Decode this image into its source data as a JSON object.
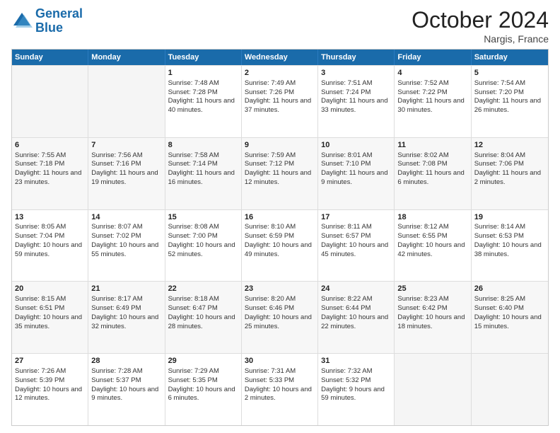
{
  "header": {
    "logo_line1": "General",
    "logo_line2": "Blue",
    "month": "October 2024",
    "location": "Nargis, France"
  },
  "days_of_week": [
    "Sunday",
    "Monday",
    "Tuesday",
    "Wednesday",
    "Thursday",
    "Friday",
    "Saturday"
  ],
  "rows": [
    [
      {
        "day": "",
        "empty": true
      },
      {
        "day": "",
        "empty": true
      },
      {
        "day": "1",
        "sunrise": "Sunrise: 7:48 AM",
        "sunset": "Sunset: 7:28 PM",
        "daylight": "Daylight: 11 hours and 40 minutes."
      },
      {
        "day": "2",
        "sunrise": "Sunrise: 7:49 AM",
        "sunset": "Sunset: 7:26 PM",
        "daylight": "Daylight: 11 hours and 37 minutes."
      },
      {
        "day": "3",
        "sunrise": "Sunrise: 7:51 AM",
        "sunset": "Sunset: 7:24 PM",
        "daylight": "Daylight: 11 hours and 33 minutes."
      },
      {
        "day": "4",
        "sunrise": "Sunrise: 7:52 AM",
        "sunset": "Sunset: 7:22 PM",
        "daylight": "Daylight: 11 hours and 30 minutes."
      },
      {
        "day": "5",
        "sunrise": "Sunrise: 7:54 AM",
        "sunset": "Sunset: 7:20 PM",
        "daylight": "Daylight: 11 hours and 26 minutes."
      }
    ],
    [
      {
        "day": "6",
        "sunrise": "Sunrise: 7:55 AM",
        "sunset": "Sunset: 7:18 PM",
        "daylight": "Daylight: 11 hours and 23 minutes."
      },
      {
        "day": "7",
        "sunrise": "Sunrise: 7:56 AM",
        "sunset": "Sunset: 7:16 PM",
        "daylight": "Daylight: 11 hours and 19 minutes."
      },
      {
        "day": "8",
        "sunrise": "Sunrise: 7:58 AM",
        "sunset": "Sunset: 7:14 PM",
        "daylight": "Daylight: 11 hours and 16 minutes."
      },
      {
        "day": "9",
        "sunrise": "Sunrise: 7:59 AM",
        "sunset": "Sunset: 7:12 PM",
        "daylight": "Daylight: 11 hours and 12 minutes."
      },
      {
        "day": "10",
        "sunrise": "Sunrise: 8:01 AM",
        "sunset": "Sunset: 7:10 PM",
        "daylight": "Daylight: 11 hours and 9 minutes."
      },
      {
        "day": "11",
        "sunrise": "Sunrise: 8:02 AM",
        "sunset": "Sunset: 7:08 PM",
        "daylight": "Daylight: 11 hours and 6 minutes."
      },
      {
        "day": "12",
        "sunrise": "Sunrise: 8:04 AM",
        "sunset": "Sunset: 7:06 PM",
        "daylight": "Daylight: 11 hours and 2 minutes."
      }
    ],
    [
      {
        "day": "13",
        "sunrise": "Sunrise: 8:05 AM",
        "sunset": "Sunset: 7:04 PM",
        "daylight": "Daylight: 10 hours and 59 minutes."
      },
      {
        "day": "14",
        "sunrise": "Sunrise: 8:07 AM",
        "sunset": "Sunset: 7:02 PM",
        "daylight": "Daylight: 10 hours and 55 minutes."
      },
      {
        "day": "15",
        "sunrise": "Sunrise: 8:08 AM",
        "sunset": "Sunset: 7:00 PM",
        "daylight": "Daylight: 10 hours and 52 minutes."
      },
      {
        "day": "16",
        "sunrise": "Sunrise: 8:10 AM",
        "sunset": "Sunset: 6:59 PM",
        "daylight": "Daylight: 10 hours and 49 minutes."
      },
      {
        "day": "17",
        "sunrise": "Sunrise: 8:11 AM",
        "sunset": "Sunset: 6:57 PM",
        "daylight": "Daylight: 10 hours and 45 minutes."
      },
      {
        "day": "18",
        "sunrise": "Sunrise: 8:12 AM",
        "sunset": "Sunset: 6:55 PM",
        "daylight": "Daylight: 10 hours and 42 minutes."
      },
      {
        "day": "19",
        "sunrise": "Sunrise: 8:14 AM",
        "sunset": "Sunset: 6:53 PM",
        "daylight": "Daylight: 10 hours and 38 minutes."
      }
    ],
    [
      {
        "day": "20",
        "sunrise": "Sunrise: 8:15 AM",
        "sunset": "Sunset: 6:51 PM",
        "daylight": "Daylight: 10 hours and 35 minutes."
      },
      {
        "day": "21",
        "sunrise": "Sunrise: 8:17 AM",
        "sunset": "Sunset: 6:49 PM",
        "daylight": "Daylight: 10 hours and 32 minutes."
      },
      {
        "day": "22",
        "sunrise": "Sunrise: 8:18 AM",
        "sunset": "Sunset: 6:47 PM",
        "daylight": "Daylight: 10 hours and 28 minutes."
      },
      {
        "day": "23",
        "sunrise": "Sunrise: 8:20 AM",
        "sunset": "Sunset: 6:46 PM",
        "daylight": "Daylight: 10 hours and 25 minutes."
      },
      {
        "day": "24",
        "sunrise": "Sunrise: 8:22 AM",
        "sunset": "Sunset: 6:44 PM",
        "daylight": "Daylight: 10 hours and 22 minutes."
      },
      {
        "day": "25",
        "sunrise": "Sunrise: 8:23 AM",
        "sunset": "Sunset: 6:42 PM",
        "daylight": "Daylight: 10 hours and 18 minutes."
      },
      {
        "day": "26",
        "sunrise": "Sunrise: 8:25 AM",
        "sunset": "Sunset: 6:40 PM",
        "daylight": "Daylight: 10 hours and 15 minutes."
      }
    ],
    [
      {
        "day": "27",
        "sunrise": "Sunrise: 7:26 AM",
        "sunset": "Sunset: 5:39 PM",
        "daylight": "Daylight: 10 hours and 12 minutes."
      },
      {
        "day": "28",
        "sunrise": "Sunrise: 7:28 AM",
        "sunset": "Sunset: 5:37 PM",
        "daylight": "Daylight: 10 hours and 9 minutes."
      },
      {
        "day": "29",
        "sunrise": "Sunrise: 7:29 AM",
        "sunset": "Sunset: 5:35 PM",
        "daylight": "Daylight: 10 hours and 6 minutes."
      },
      {
        "day": "30",
        "sunrise": "Sunrise: 7:31 AM",
        "sunset": "Sunset: 5:33 PM",
        "daylight": "Daylight: 10 hours and 2 minutes."
      },
      {
        "day": "31",
        "sunrise": "Sunrise: 7:32 AM",
        "sunset": "Sunset: 5:32 PM",
        "daylight": "Daylight: 9 hours and 59 minutes."
      },
      {
        "day": "",
        "empty": true
      },
      {
        "day": "",
        "empty": true
      }
    ]
  ]
}
